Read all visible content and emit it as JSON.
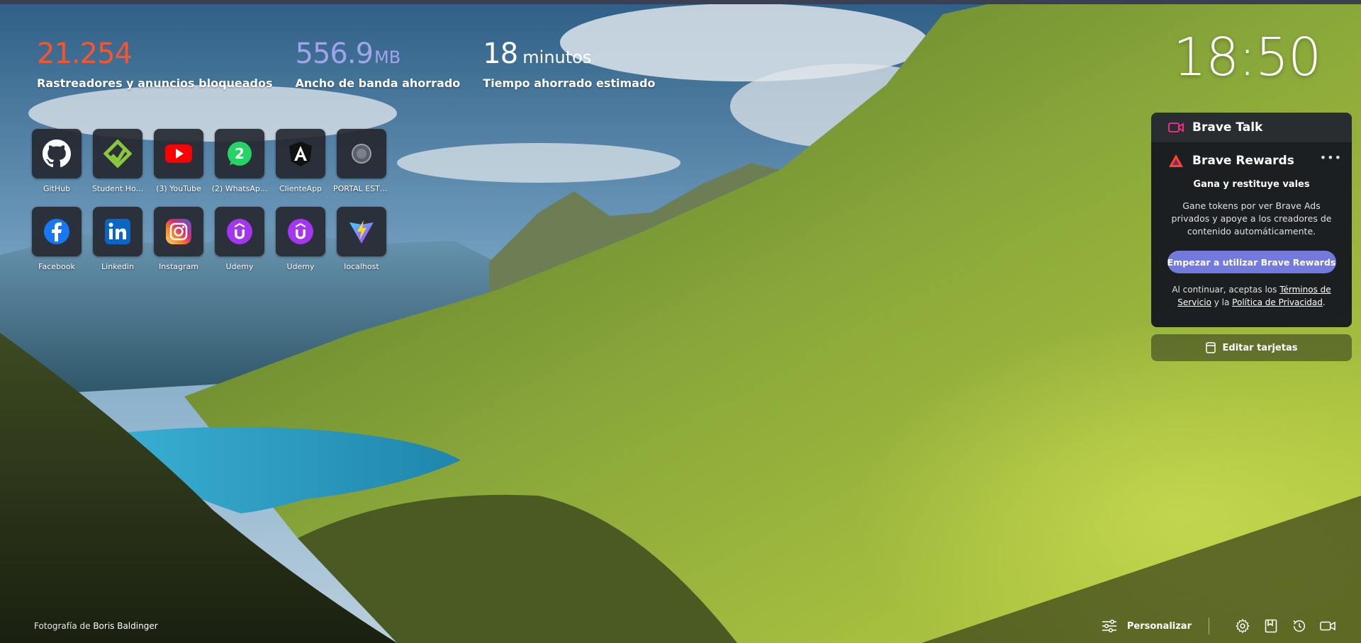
{
  "stats": {
    "trackers": {
      "value": "21.254",
      "label": "Rastreadores y anuncios bloqueados"
    },
    "bandwidth": {
      "value": "556.9",
      "unit": "MB",
      "label": "Ancho de banda ahorrado"
    },
    "time": {
      "value": "18",
      "unit": "minutos",
      "label": "Tiempo ahorrado estimado"
    }
  },
  "clock": "18:50",
  "top_sites": [
    {
      "name": "GitHub",
      "icon": "github-icon"
    },
    {
      "name": "Student Ho...",
      "icon": "student-hub-icon"
    },
    {
      "name": "(3) YouTube",
      "icon": "youtube-icon"
    },
    {
      "name": "(2) WhatsAp...",
      "icon": "whatsapp-icon"
    },
    {
      "name": "ClienteApp",
      "icon": "angular-icon"
    },
    {
      "name": "PORTAL ESTU...",
      "icon": "portal-seal-icon"
    },
    {
      "name": "Facebook",
      "icon": "facebook-icon"
    },
    {
      "name": "Linkedin",
      "icon": "linkedin-icon"
    },
    {
      "name": "Instagram",
      "icon": "instagram-icon"
    },
    {
      "name": "Udemy",
      "icon": "udemy-icon"
    },
    {
      "name": "Udemy",
      "icon": "udemy-icon"
    },
    {
      "name": "localhost",
      "icon": "vite-icon"
    }
  ],
  "widgets": {
    "talk": {
      "label": "Brave Talk"
    },
    "rewards": {
      "label": "Brave Rewards",
      "more": "•••",
      "subtitle": "Gana y restituye vales",
      "description": "Gane tokens por ver Brave Ads privados y apoye a los creadores de contenido automáticamente.",
      "cta": "Empezar a utilizar Brave Rewards",
      "terms_prefix": "Al continuar, aceptas los ",
      "terms_link": "Términos de Servicio",
      "terms_middle": " y la ",
      "privacy_link": "Política de Privacidad",
      "terms_suffix": "."
    },
    "edit_cards": "Editar tarjetas"
  },
  "footer": {
    "credit_prefix": "Fotografía de ",
    "credit_author": "Boris Baldinger",
    "customize": "Personalizar"
  },
  "colors": {
    "trackers": "#fb542b",
    "bandwidth": "#a0a5eb",
    "rewards_button": "#737ade",
    "brave_talk_accent": "#ff2c8c"
  }
}
